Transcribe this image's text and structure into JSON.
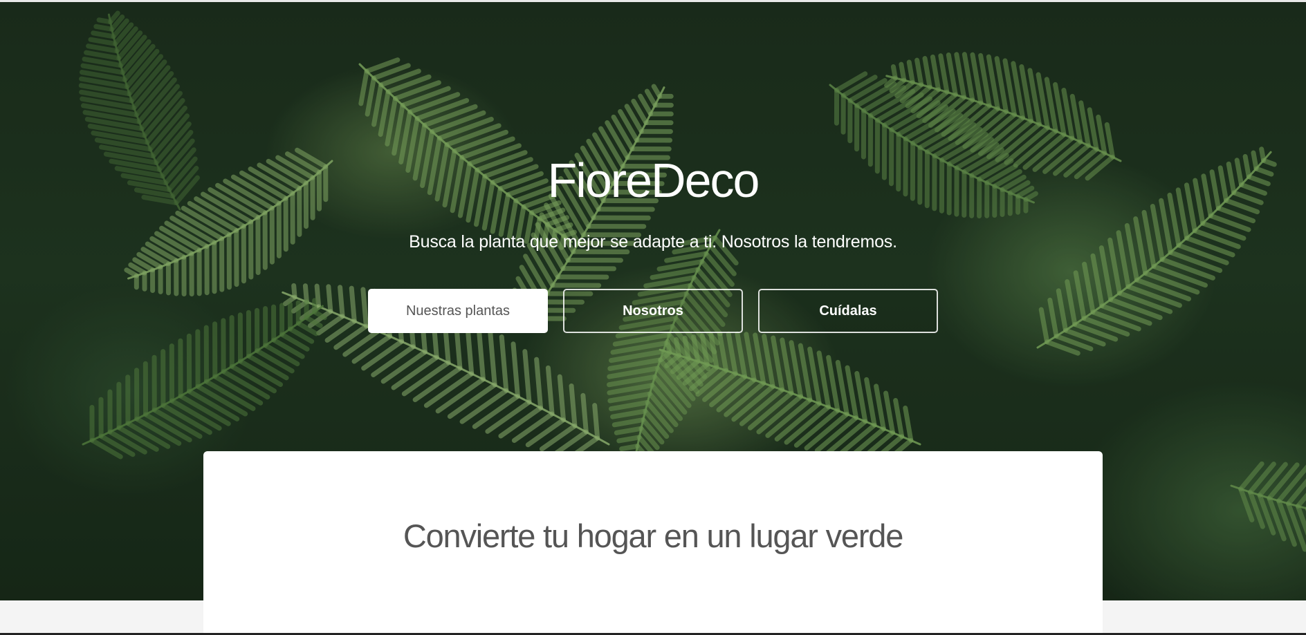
{
  "hero": {
    "brand": "FioreDeco",
    "tagline": "Busca la planta que mejor se adapte a ti. Nosotros la tendremos.",
    "background_image": "fern-leaves-photo",
    "buttons": [
      {
        "label": "Nuestras plantas",
        "style": "solid"
      },
      {
        "label": "Nosotros",
        "style": "outline"
      },
      {
        "label": "Cuídalas",
        "style": "outline"
      }
    ]
  },
  "section": {
    "title": "Convierte tu hogar en un lugar verde"
  },
  "colors": {
    "hero_green_dark": "#1f3420",
    "fern_green": "#7fae5e",
    "text_white": "#ffffff",
    "text_gray": "#555555",
    "page_bg": "#f4f4f4"
  }
}
